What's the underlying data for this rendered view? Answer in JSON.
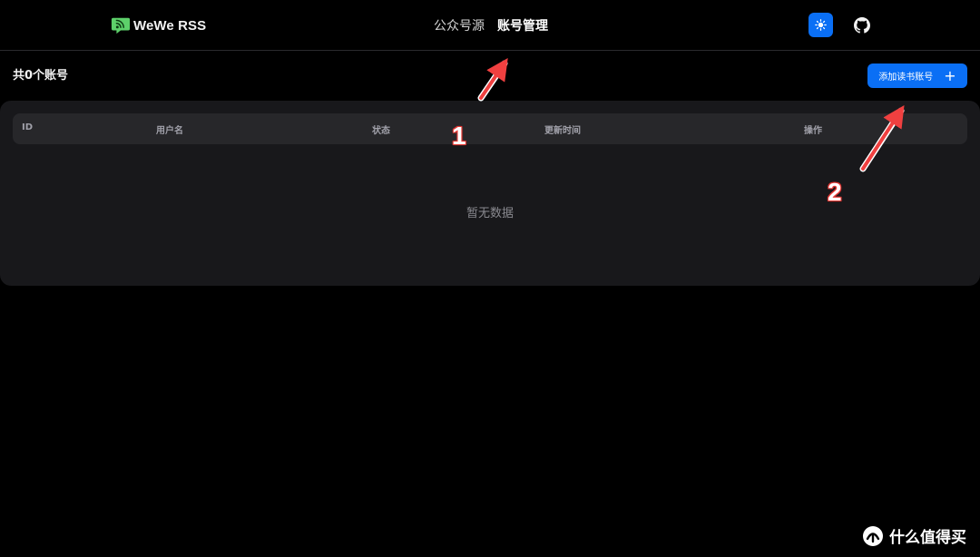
{
  "app": {
    "brand_name": "WeWe RSS"
  },
  "nav": {
    "items": [
      {
        "label": "公众号源",
        "active": false
      },
      {
        "label": "账号管理",
        "active": true
      }
    ]
  },
  "header_actions": {
    "theme_icon": "sun-icon",
    "github_icon": "github-icon"
  },
  "page": {
    "count_text": "共0个账号",
    "add_button_label": "添加读书账号",
    "add_button_icon": "plus-icon"
  },
  "table": {
    "columns": [
      "ID",
      "用户名",
      "状态",
      "更新时间",
      "操作"
    ],
    "rows": [],
    "empty_text": "暂无数据"
  },
  "annotations": {
    "labels": [
      "1",
      "2"
    ],
    "color": "#e53935"
  },
  "watermark": {
    "text": "什么值得买"
  },
  "colors": {
    "accent": "#0a6ff5",
    "background": "#000000",
    "card": "#18181b",
    "header_row": "#27272a"
  }
}
